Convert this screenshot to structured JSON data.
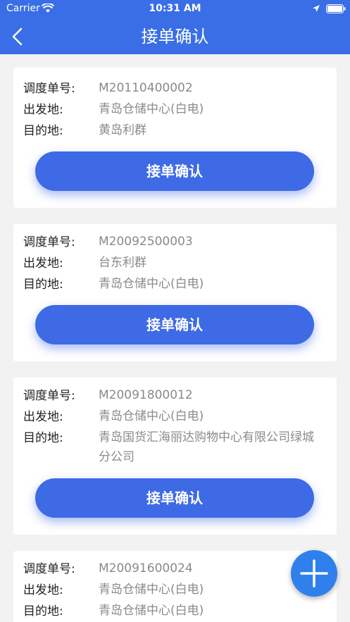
{
  "status_bar": {
    "carrier": "Carrier",
    "time": "10:31 AM"
  },
  "nav": {
    "title": "接单确认"
  },
  "labels": {
    "order_no": "调度单号:",
    "origin": "出发地:",
    "destination": "目的地:"
  },
  "orders": [
    {
      "order_no": "M20110400002",
      "origin": "青岛仓储中心(白电)",
      "destination": "黄岛利群",
      "button": "接单确认"
    },
    {
      "order_no": "M20092500003",
      "origin": "台东利群",
      "destination": "青岛仓储中心(白电)",
      "button": "接单确认"
    },
    {
      "order_no": "M20091800012",
      "origin": "青岛仓储中心(白电)",
      "destination": "青岛国货汇海丽达购物中心有限公司绿城分公司",
      "button": "接单确认"
    },
    {
      "order_no": "M20091600024",
      "origin": "青岛仓储中心(白电)",
      "destination": "青岛仓储中心(白电)"
    }
  ],
  "icons": {
    "back": "chevron-left-icon",
    "fab": "plus-icon",
    "wifi": "wifi-icon",
    "location": "location-arrow-icon",
    "battery": "battery-icon"
  },
  "colors": {
    "header": "#3a6ee6",
    "button": "#3f6ae6",
    "fab": "#2f80ed",
    "background": "#f2f2f2"
  }
}
